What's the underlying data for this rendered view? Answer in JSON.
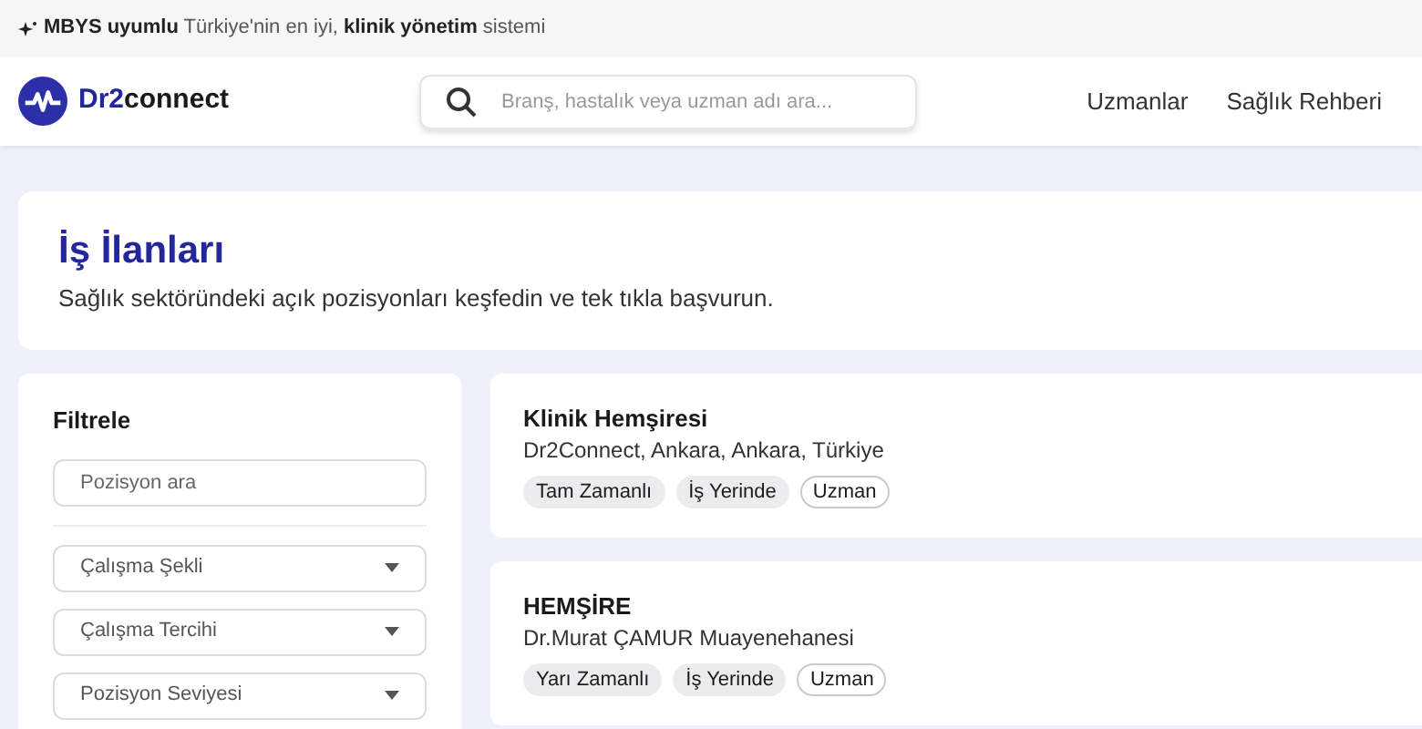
{
  "announcement": "**MBYS uyumlu** Türkiye'nin en iyi, **klinik yönetim** sistemi",
  "header": {
    "brand": [
      "Dr2",
      "connect"
    ],
    "search": {
      "placeholder": "Branş, hastalık veya uzman adı ara..."
    },
    "nav": [
      "Uzmanlar",
      "Sağlık Rehberi"
    ]
  },
  "hero": {
    "title": "İş İlanları",
    "subtitle": "Sağlık sektöründeki açık pozisyonları keşfedin ve tek tıkla başvurun."
  },
  "filters": {
    "title": "Filtrele",
    "search": {
      "placeholder": "Pozisyon ara"
    },
    "selects": [
      "Çalışma Şekli",
      "Çalışma Tercihi",
      "Pozisyon Seviyesi"
    ]
  },
  "jobs": [
    {
      "title": "Klinik Hemşiresi",
      "employer": "Dr2Connect, Ankara, Ankara, Türkiye",
      "tags": [
        {
          "label": "Tam Zamanlı",
          "kind": "filled"
        },
        {
          "label": "İş Yerinde",
          "kind": "filled"
        },
        {
          "label": "Uzman",
          "kind": "outlined"
        }
      ]
    },
    {
      "title": "HEMŞİRE",
      "employer": "Dr.Murat ÇAMUR Muayenehanesi",
      "tags": [
        {
          "label": "Yarı Zamanlı",
          "kind": "filled"
        },
        {
          "label": "İş Yerinde",
          "kind": "filled"
        },
        {
          "label": "Uzman",
          "kind": "outlined"
        }
      ]
    }
  ]
}
